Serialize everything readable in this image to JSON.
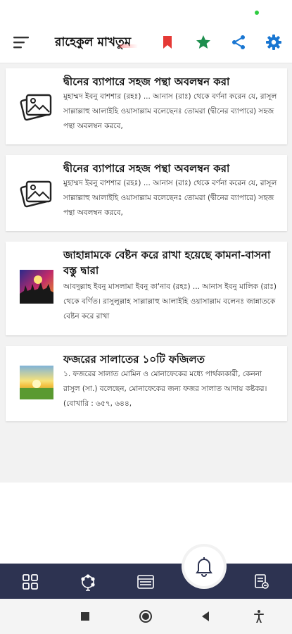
{
  "app": {
    "title": "রাহেকুল মাখতুম"
  },
  "icons": {
    "menu": "hamburger-menu-icon",
    "bookmark": "bookmark-icon",
    "favorite": "star-icon",
    "share": "share-icon",
    "settings": "gear-icon"
  },
  "colors": {
    "bookmark": "#e53935",
    "star": "#1e8e4e",
    "share": "#1976d2",
    "settings": "#1976d2",
    "nav_bar": "#2d3351"
  },
  "posts": [
    {
      "title": "দ্বীনের ব্যাপারে সহজ পন্থা অবলম্বন করা",
      "excerpt": "মুহাম্মদ ইবনু বাশশার (রহঃ) ... আনাস (রাঃ) থেকে বর্ণনা করেন যে, রাসূল সাল্লাল্লাহু আলাইহি ওয়াসাল্লাম বলেছেনঃ তোমরা (দ্বীনের ব্যাপারে) সহজ পন্থা অবলম্বন করবে,",
      "thumb": "image-placeholder-icon"
    },
    {
      "title": "দ্বীনের ব্যাপারে সহজ পন্থা অবলম্বন করা",
      "excerpt": "মুহাম্মদ ইবনু বাশশার (রহঃ) ... আনাস (রাঃ) থেকে বর্ণনা করেন যে, রাসূল সাল্লাল্লাহু আলাইহি ওয়াসাল্লাম বলেছেনঃ তোমরা (দ্বীনের ব্যাপারে) সহজ পন্থা অবলম্বন করবে,",
      "thumb": "image-placeholder-icon"
    },
    {
      "title": "জাহান্নামকে বেষ্টন করে রাখা হয়েছে কামনা-বাসনা বস্তু দ্বারা",
      "excerpt": "আবদুল্লাহ ইবনু মাসলামা ইবনু কা'নাব (রহঃ) ... আনাস ইবনু মালিক (রাঃ) থেকে বর্ণিত। রাসুলুল্লাহ সাল্লাল্লাহু আলাইহি ওয়াসাল্লাম বলেনঃ জান্নাতকে বেষ্টন করে রাখা",
      "thumb": "crowd-photo-thumbnail"
    },
    {
      "title": "ফজরের সালাতের ১০টি ফজিলত",
      "excerpt": "১. ফজরের সালাত মোমিন ও মোনাফেকের মধ্যে পার্থক্যকারী, কেননা রাসুল (সা.) বলেছেন, মোনাফেকের জন্য ফজর সালাত আদায় কষ্টকর। (বোখারি : ৬৫৭, ৬৪৪,",
      "thumb": "sunrise-photo-thumbnail"
    }
  ],
  "bottom_nav": [
    "grid-icon",
    "tasbih-icon",
    "calendar-icon",
    "bell-icon",
    "document-icon"
  ],
  "system_nav": [
    "recents-icon",
    "home-icon",
    "back-icon",
    "accessibility-icon"
  ]
}
